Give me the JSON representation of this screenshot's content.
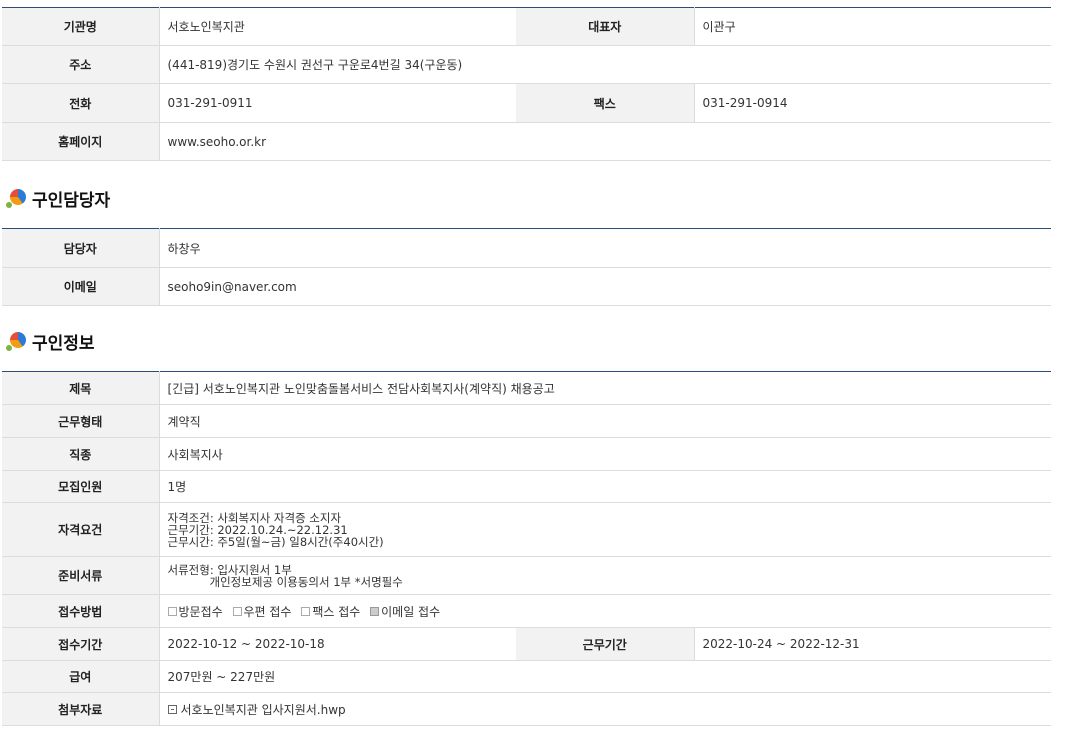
{
  "org": {
    "name_label": "기관명",
    "name": "서호노인복지관",
    "rep_label": "대표자",
    "rep": "이관구",
    "addr_label": "주소",
    "addr": "(441-819)경기도 수원시 권선구 구운로4번길 34(구운동)",
    "tel_label": "전화",
    "tel": "031-291-0911",
    "fax_label": "팩스",
    "fax": "031-291-0914",
    "home_label": "홈페이지",
    "home": "www.seoho.or.kr"
  },
  "contact_title": "구인담당자",
  "contact": {
    "person_label": "담당자",
    "person": "하창우",
    "email_label": "이메일",
    "email": "seoho9in@naver.com"
  },
  "job_title": "구인정보",
  "job": {
    "subject_label": "제목",
    "subject": "[긴급] 서호노인복지관 노인맞춤돌봄서비스 전담사회복지사(계약직) 채용공고",
    "type_label": "근무형태",
    "type": "계약직",
    "occupation_label": "직종",
    "occupation": "사회복지사",
    "headcount_label": "모집인원",
    "headcount": "1명",
    "qual_label": "자격요건",
    "qual_lines": [
      "자격조건: 사회복지사 자격증 소지자",
      "근무기간: 2022.10.24.~22.12.31",
      "근무시간: 주5일(월~금) 일8시간(주40시간)"
    ],
    "docs_label": "준비서류",
    "docs_lines": [
      "서류전형: 입사지원서 1부",
      "개인정보제공 이용동의서 1부  *서명필수"
    ],
    "method_label": "접수방법",
    "methods": [
      {
        "label": "방문접수",
        "checked": false
      },
      {
        "label": "우편 접수",
        "checked": false
      },
      {
        "label": "팩스 접수",
        "checked": false
      },
      {
        "label": "이메일 접수",
        "checked": true
      }
    ],
    "apply_period_label": "접수기간",
    "apply_period": "2022-10-12 ~ 2022-10-18",
    "work_period_label": "근무기간",
    "work_period": "2022-10-24 ~ 2022-12-31",
    "salary_label": "급여",
    "salary": "207만원 ~ 227만원",
    "attach_label": "첨부자료",
    "attach": "서호노인복지관 입사지원서.hwp"
  }
}
